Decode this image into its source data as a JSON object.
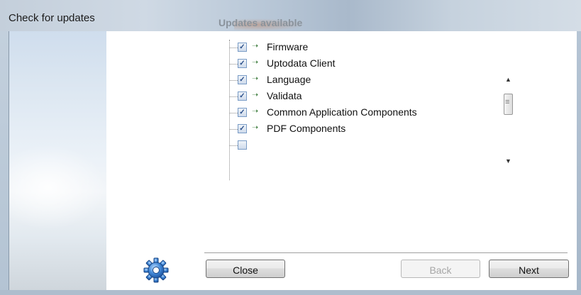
{
  "window": {
    "title": "Check for updates"
  },
  "main": {
    "heading": "Updates available",
    "items": [
      {
        "label": "Firmware",
        "checked": true
      },
      {
        "label": "Uptodata Client",
        "checked": true
      },
      {
        "label": "Language",
        "checked": true
      },
      {
        "label": "Validata",
        "checked": true
      },
      {
        "label": "Common Application Components",
        "checked": true
      },
      {
        "label": "PDF Components",
        "checked": true
      }
    ]
  },
  "icons": {
    "gear": "gear-icon",
    "arrow": "green-arrow-icon",
    "scroll_up": "scroll-up-arrow-icon",
    "scroll_down": "scroll-down-arrow-icon"
  },
  "buttons": {
    "close": "Close",
    "back": "Back",
    "next": "Next",
    "back_enabled": false
  }
}
